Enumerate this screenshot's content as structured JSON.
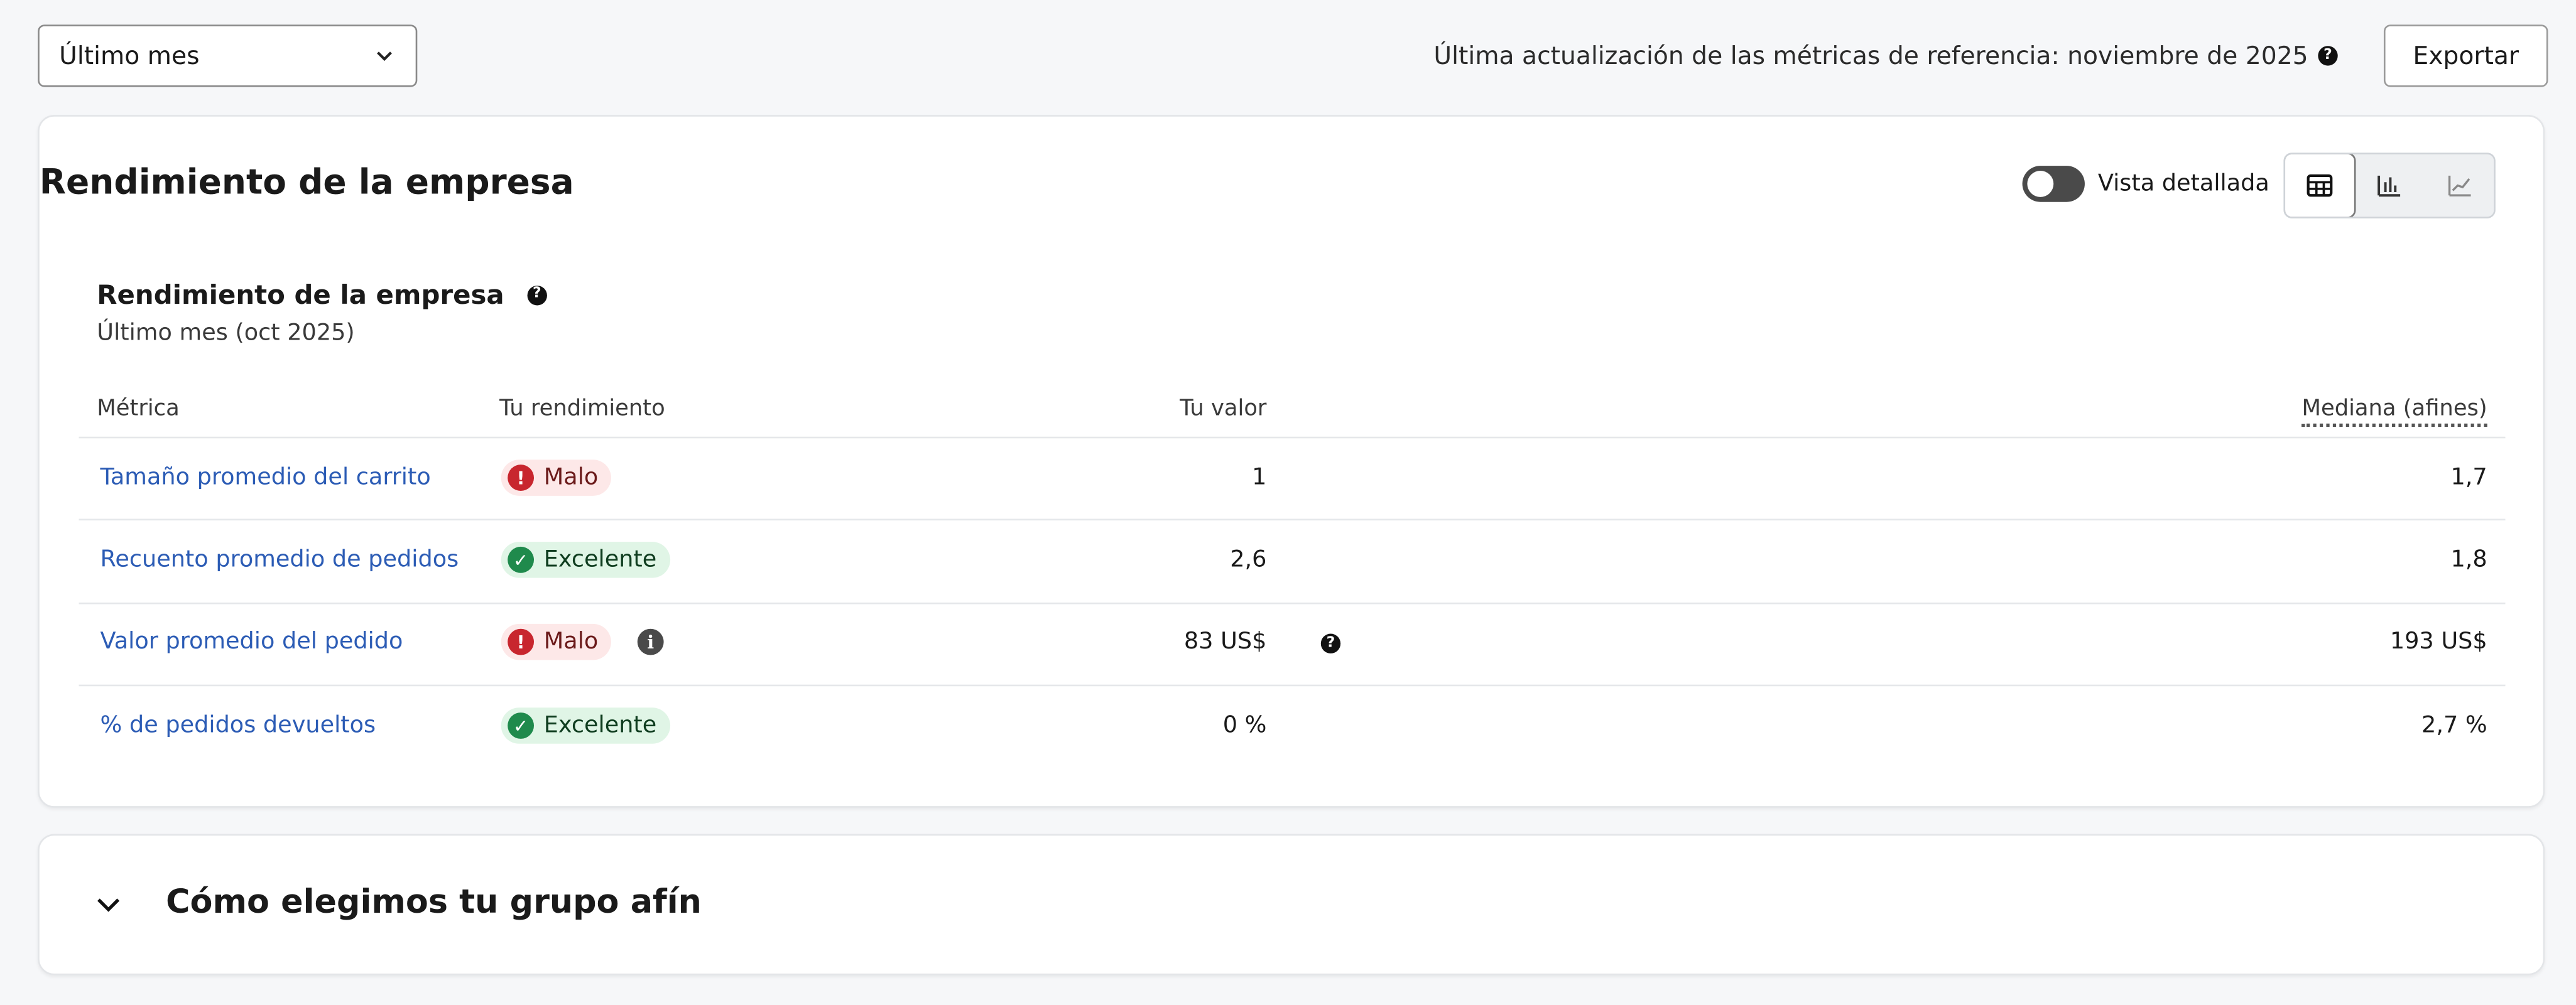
{
  "filters": {
    "period_selected": "Último mes"
  },
  "header": {
    "last_updated_text": "Última actualización de las métricas de referencia: noviembre de 2025",
    "export_label": "Exportar"
  },
  "card": {
    "title": "Rendimiento de la empresa",
    "detailed_view_label": "Vista detallada",
    "view_modes": [
      "table",
      "bar-chart",
      "line-chart"
    ],
    "section_title": "Rendimiento de la empresa",
    "section_subtitle": "Último mes (oct 2025)"
  },
  "table": {
    "columns": {
      "metric": "Métrica",
      "performance": "Tu rendimiento",
      "value": "Tu valor",
      "median": "Mediana (afines)"
    },
    "rows": [
      {
        "metric": "Tamaño promedio del carrito",
        "status": "Malo",
        "value": "1",
        "median": "1,7"
      },
      {
        "metric": "Recuento promedio de pedidos",
        "status": "Excelente",
        "value": "2,6",
        "median": "1,8"
      },
      {
        "metric": "Valor promedio del pedido",
        "status": "Malo",
        "value": "83 US$",
        "median": "193 US$"
      },
      {
        "metric": "% de pedidos devueltos",
        "status": "Excelente",
        "value": "0 %",
        "median": "2,7 %"
      }
    ]
  },
  "peer_section": {
    "title": "Cómo elegimos tu grupo afín"
  },
  "colors": {
    "link": "#2c5cb5",
    "bad": "#c8262e",
    "good": "#1f8a4c"
  }
}
